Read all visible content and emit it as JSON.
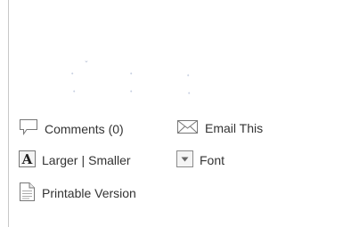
{
  "tools": {
    "comments_label": "Comments (0)",
    "email_label": "Email This",
    "larger_label": "Larger",
    "separator": "|",
    "smaller_label": "Smaller",
    "font_label": "Font",
    "printable_label": "Printable Version"
  },
  "icons": {
    "comments": "speech-bubble-icon",
    "email": "envelope-icon",
    "text_size": "letter-a-icon",
    "font": "dropdown-arrow-icon",
    "printable": "document-icon",
    "loading": "loading-spinner-icon"
  },
  "colors": {
    "text": "#333333",
    "icon_stroke": "#777777",
    "spinner": "#c6cfe0"
  }
}
